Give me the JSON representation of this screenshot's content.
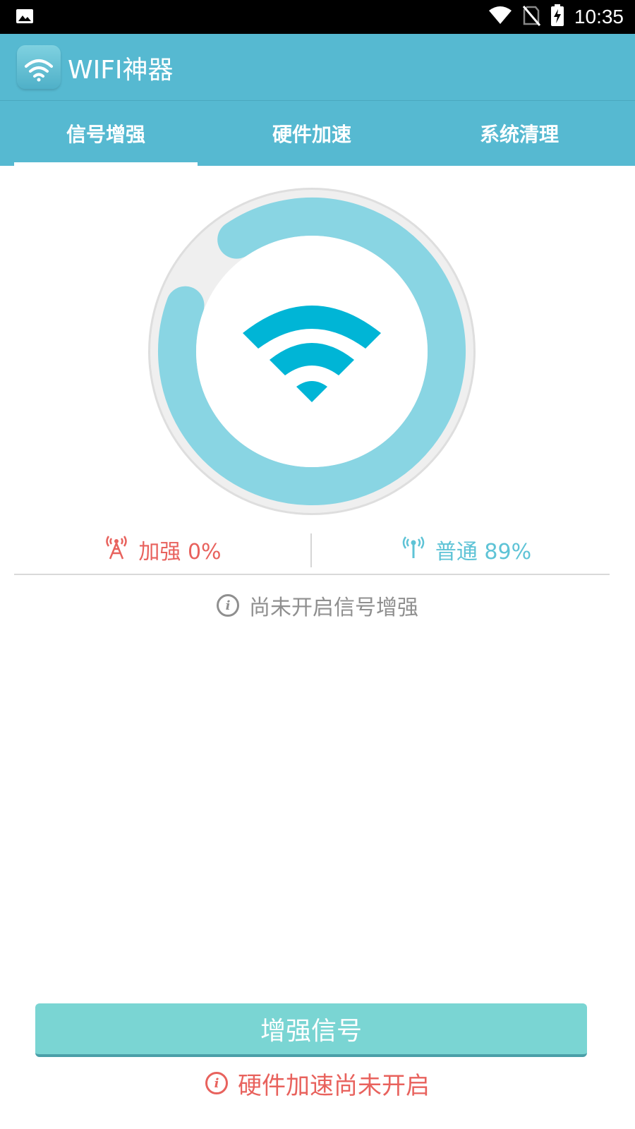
{
  "status_bar": {
    "time": "10:35",
    "icons": [
      "image-icon",
      "wifi-icon",
      "no-sim-icon",
      "battery-charging-icon"
    ]
  },
  "app_bar": {
    "title": "WIFI神器",
    "icon": "wifi-app-icon"
  },
  "tabs": [
    {
      "label": "信号增强",
      "selected": true
    },
    {
      "label": "硬件加速",
      "selected": false
    },
    {
      "label": "系统清理",
      "selected": false
    }
  ],
  "gauge": {
    "icon": "wifi-icon",
    "progress_fraction": 0.9,
    "colors": {
      "track": "#e6e6e6",
      "progress": "#89d5e3",
      "wifi": "#00b5d6"
    }
  },
  "stats": {
    "boost": {
      "label": "加强 0%",
      "icon": "signal-tower-icon",
      "color": "#e8625d"
    },
    "normal": {
      "label": "普通 89%",
      "icon": "antenna-icon",
      "color": "#5ec3d6"
    }
  },
  "hint": {
    "text": "尚未开启信号增强",
    "icon": "info-icon"
  },
  "primary_button": {
    "label": "增强信号"
  },
  "footer_warning": {
    "text": "硬件加速尚未开启",
    "icon": "info-icon"
  },
  "colors": {
    "primary": "#56b9d1",
    "button": "#7ad5d3",
    "warning": "#e8625d"
  }
}
